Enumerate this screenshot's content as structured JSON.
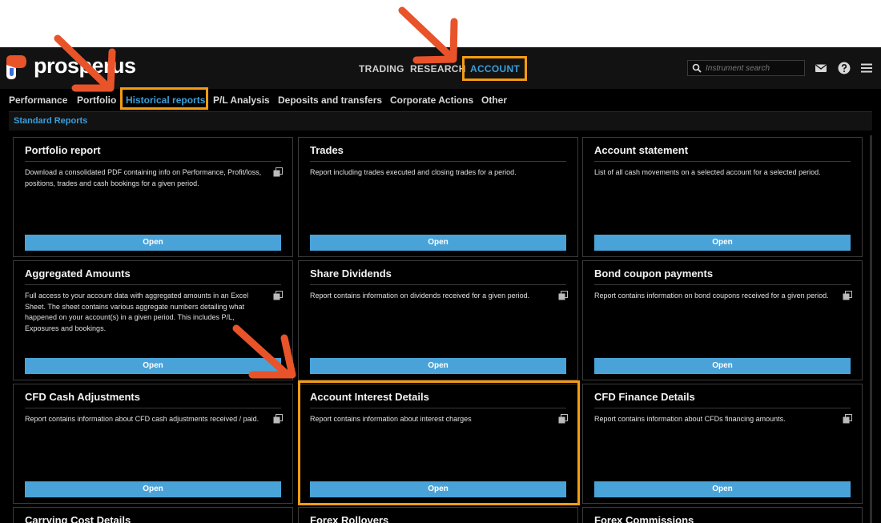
{
  "brand": {
    "name": "prosperus"
  },
  "top_nav": [
    {
      "label": "TRADING",
      "active": false
    },
    {
      "label": "RESEARCH",
      "active": false
    },
    {
      "label": "ACCOUNT",
      "active": true
    }
  ],
  "search": {
    "placeholder": "Instrument search"
  },
  "header_icons": [
    "mail-icon",
    "help-icon",
    "menu-icon"
  ],
  "sub_nav": [
    {
      "label": "Performance",
      "active": false
    },
    {
      "label": "Portfolio",
      "active": false
    },
    {
      "label": "Historical reports",
      "active": true
    },
    {
      "label": "P/L Analysis",
      "active": false
    },
    {
      "label": "Deposits and transfers",
      "active": false
    },
    {
      "label": "Corporate Actions",
      "active": false
    },
    {
      "label": "Other",
      "active": false
    }
  ],
  "section": {
    "title": "Standard Reports"
  },
  "reports": [
    {
      "title": "Portfolio report",
      "description": "Download a consolidated PDF containing info on Performance, Profit/loss, positions, trades and cash bookings for a given period.",
      "button": "Open"
    },
    {
      "title": "Trades",
      "description": "Report including trades executed and closing trades for a period.",
      "button": "Open"
    },
    {
      "title": "Account statement",
      "description": "List of all cash movements on a selected account for a selected period.",
      "button": "Open"
    },
    {
      "title": "Aggregated Amounts",
      "description": "Full access to your account data with aggregated amounts in an Excel Sheet. The sheet contains various aggregate numbers detailing what happened on your account(s) in a given period. This includes P/L, Exposures and bookings.",
      "button": "Open"
    },
    {
      "title": "Share Dividends",
      "description": "Report contains information on dividends received for a given period.",
      "button": "Open"
    },
    {
      "title": "Bond coupon payments",
      "description": "Report contains information on bond coupons received for a given period.",
      "button": "Open"
    },
    {
      "title": "CFD Cash Adjustments",
      "description": "Report contains information about CFD cash adjustments received / paid.",
      "button": "Open"
    },
    {
      "title": "Account Interest Details",
      "description": "Report contains information about interest charges",
      "button": "Open"
    },
    {
      "title": "CFD Finance Details",
      "description": "Report contains information about CFDs financing amounts.",
      "button": "Open"
    },
    {
      "title": "Carrying Cost Details",
      "description": "",
      "button": ""
    },
    {
      "title": "Forex Rollovers",
      "description": "",
      "button": ""
    },
    {
      "title": "Forex Commissions",
      "description": "",
      "button": ""
    }
  ],
  "colors": {
    "accent": "#3a9fdc",
    "highlight": "#f39c12",
    "arrow": "#e8532a",
    "button": "#4aa3d8"
  }
}
